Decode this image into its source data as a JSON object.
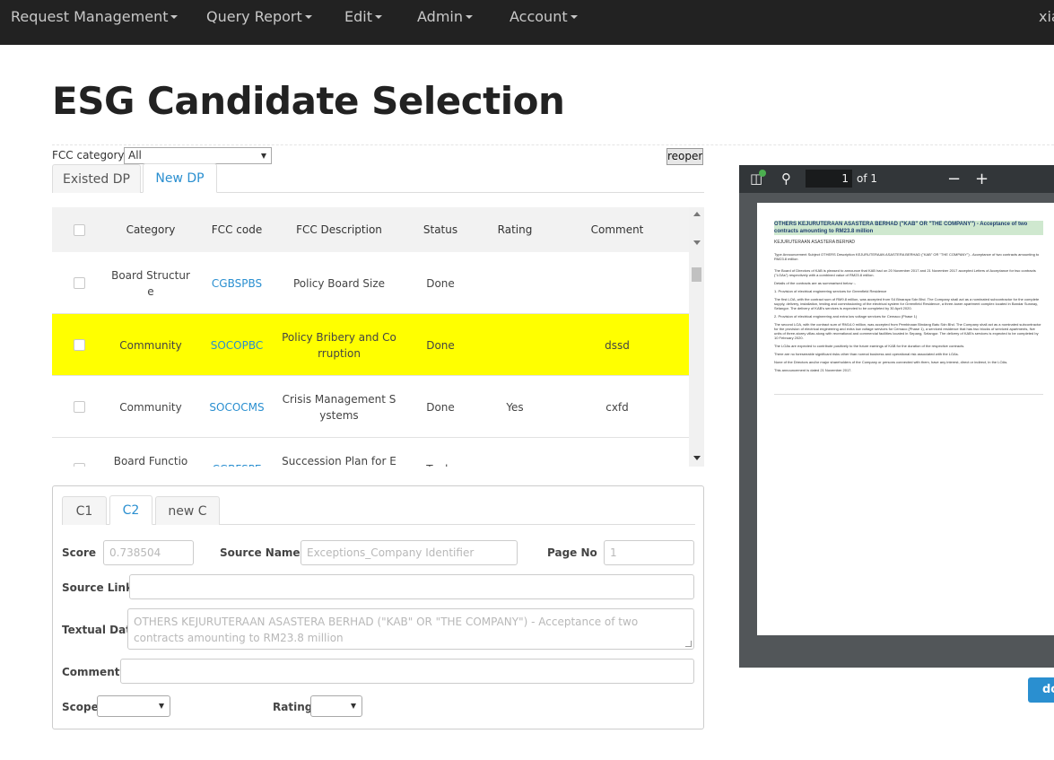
{
  "nav": {
    "items": [
      "Request Management",
      "Query Report",
      "Edit",
      "Admin",
      "Account"
    ],
    "user": "xia"
  },
  "page": {
    "title": "ESG Candidate Selection"
  },
  "filter": {
    "label": "FCC category",
    "value": "All",
    "reopen_label": "reopen"
  },
  "dp_tabs": {
    "existed": "Existed DP",
    "new": "New DP",
    "active": "New DP"
  },
  "grid": {
    "columns": [
      "Category",
      "FCC code",
      "FCC Description",
      "Status",
      "Rating",
      "Comment"
    ],
    "rows": [
      {
        "category": [
          "Board Structur",
          "e"
        ],
        "code": "CGBSPBS",
        "description": [
          "Policy Board Size",
          ""
        ],
        "status": "Done",
        "rating": "",
        "comment": "",
        "selected": false
      },
      {
        "category": [
          "Community",
          ""
        ],
        "code": "SOCOPBC",
        "description": [
          "Policy Bribery and Co",
          "rruption"
        ],
        "status": "Done",
        "rating": "",
        "comment": "dssd",
        "selected": true
      },
      {
        "category": [
          "Community",
          ""
        ],
        "code": "SOCOCMS",
        "description": [
          "Crisis Management S",
          "ystems"
        ],
        "status": "Done",
        "rating": "Yes",
        "comment": "cxfd",
        "selected": false
      },
      {
        "category": [
          "Board Functio",
          "n"
        ],
        "code": "CGBFSPE",
        "description": [
          "Succession Plan for E",
          "xecutives"
        ],
        "status": "To do",
        "rating": "",
        "comment": "",
        "selected": false
      }
    ]
  },
  "c_tabs": {
    "items": [
      "C1",
      "C2",
      "new C"
    ],
    "active": "C2"
  },
  "form": {
    "score_label": "Score",
    "score_value": "0.738504",
    "source_name_label": "Source Name",
    "source_name_value": "Exceptions_Company Identifier",
    "page_no_label": "Page No",
    "page_no_value": "1",
    "source_link_label": "Source Link",
    "source_link_value": "",
    "textual_label": "Textual Data",
    "textual_value": "OTHERS KEJURUTERAAN ASASTERA BERHAD (\"KAB\" OR \"THE COMPANY\") - Acceptance of two contracts amounting to RM23.8 million",
    "comment_label": "Comment",
    "comment_value": "",
    "scope_label": "Scope",
    "scope_value": "",
    "rating_label": "Rating",
    "rating_value": ""
  },
  "pdf": {
    "page_current": "1",
    "page_total_text": "of 1",
    "headline": "OTHERS KEJURUTERAAN ASASTERA BERHAD (\"KAB\" OR \"THE COMPANY\") - Acceptance of two contracts amounting to RM23.8 million",
    "company": "KEJURUTERAAN ASASTERA BERHAD",
    "meta": "Type  Announcement   Subject  OTHERS   Description  KEJURUTERAAN ASASTERA BERHAD (\"KAB\" OR \"THE COMPANY\") - Acceptance of two contracts amounting to RM23.8 million",
    "paragraphs": [
      "The Board of Directors of KAB is pleased to announce that KAB had on 20 November 2017 and 21 November 2017 accepted Letters of Acceptance for two contracts (\"LOAs\") respectively with a combined value of RM23.8 million.",
      "Details of the contracts are as summarised below :-",
      "1.   Provision of electrical engineering services for Greenfield Residence",
      "The first LOA, with the contract sum of RM9.8 million, was accepted from S4 Binaraya Sdn Bhd. The Company shall act as a nominated subcontractor for the complete supply, delivery, installation, testing and commissioning of the electrical system for Greenfield Residence, a three-tower apartment complex located in Bandar Sunway, Selangor. The delivery of KAB's services is expected to be completed by 30 April 2020.",
      "2.   Provision of electrical engineering and extra low voltage services for Cemaco (Phase 1)",
      "The second LOA, with the contract sum of RM14.0 million, was accepted from Pembinaan Bindang Batu Sdn Bhd. The Company shall act as a nominated subcontractor for the provision of electrical engineering and extra low voltage services for Cemaco (Phase 1), a serviced residence that has two blocks of serviced apartments, five units of three-storey villas along with recreational and commercial facilities located in Sepang, Selangor. The delivery of KAB's services is expected to be completed by 10 February 2020.",
      "The LOAs are expected to contribute positively to the future earnings of KAB for the duration of the respective contracts.",
      "There are no foreseeable significant risks other than normal business and operational risk associated with the LOAs.",
      "None of the Directors and/or major shareholders of the Company or persons connected with them, have any interest, direct or indirect, in the LOAs.",
      "This announcement is dated 21 November 2017."
    ]
  },
  "done_button": {
    "label": "do"
  },
  "colors": {
    "navbar": "#222222",
    "link": "#2a8fd0",
    "selected_row": "#ffff00",
    "pdf_bg": "#525659"
  }
}
